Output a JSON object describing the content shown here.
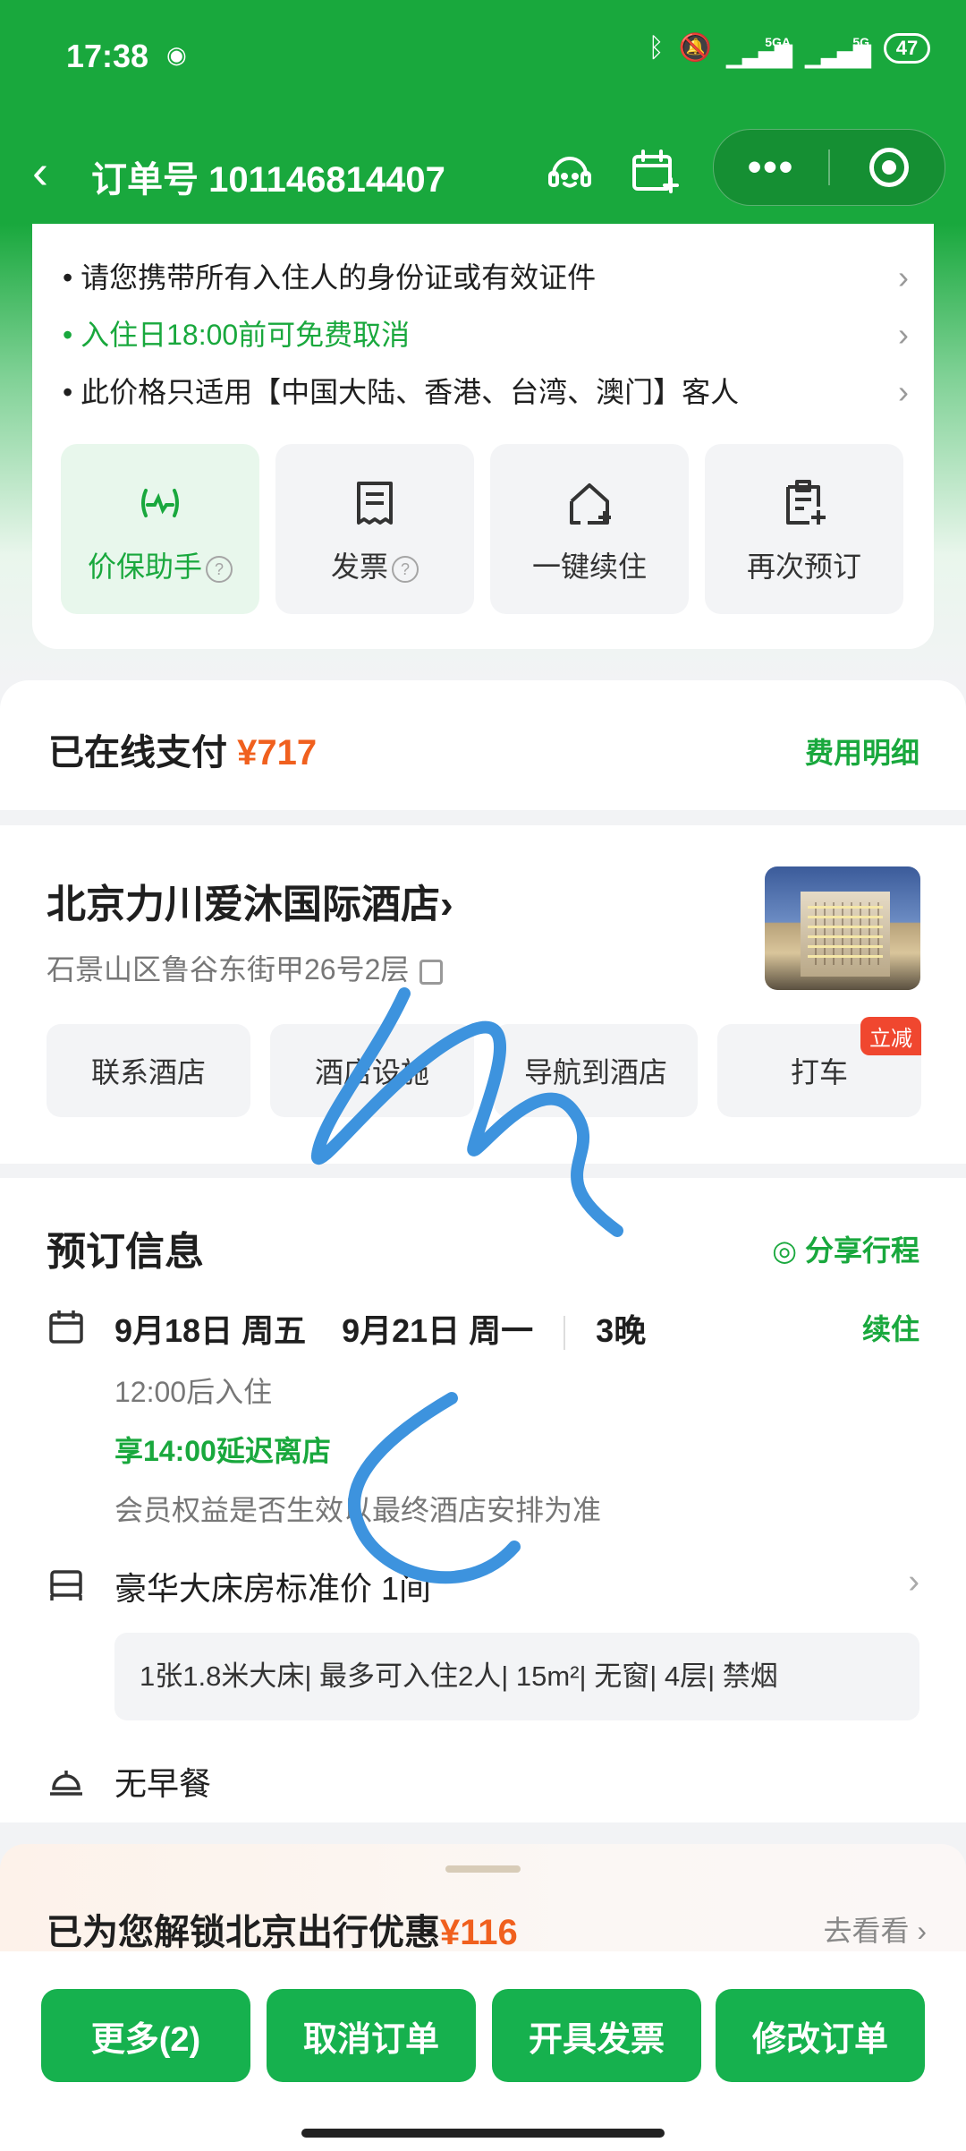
{
  "status_bar": {
    "time": "17:38",
    "network_1": "5GA",
    "network_2": "5G",
    "battery": "47"
  },
  "header": {
    "title": "订单号 101146814407"
  },
  "notices": [
    {
      "text": "请您携带所有入住人的身份证或有效证件",
      "highlight": false
    },
    {
      "text": "入住日18:00前可免费取消",
      "highlight": true
    },
    {
      "text": "此价格只适用【中国大陆、香港、台湾、澳门】客人",
      "highlight": false
    }
  ],
  "quick_actions": [
    {
      "label": "价保助手",
      "icon": "price-protect-icon"
    },
    {
      "label": "发票",
      "icon": "invoice-icon"
    },
    {
      "label": "一键续住",
      "icon": "house-plus-icon"
    },
    {
      "label": "再次预订",
      "icon": "rebook-icon"
    }
  ],
  "payment": {
    "label": "已在线支付",
    "amount": "¥717",
    "detail_link": "费用明细"
  },
  "hotel": {
    "name": "北京力川爱沐国际酒店",
    "address": "石景山区鲁谷东街甲26号2层",
    "buttons": [
      "联系酒店",
      "酒店设施",
      "导航到酒店",
      "打车"
    ],
    "taxi_badge": "立减"
  },
  "booking": {
    "title": "预订信息",
    "share": "分享行程",
    "checkin": "9月18日 周五",
    "checkout": "9月21日 周一",
    "nights": "3晚",
    "extend": "续住",
    "checkin_time": "12:00后入住",
    "late_checkout": "享14:00延迟离店",
    "member_note": "会员权益是否生效以最终酒店安排为准",
    "room": "豪华大床房标准价 1间",
    "room_detail": "1张1.8米大床| 最多可入住2人| 15m²| 无窗| 4层| 禁烟",
    "meal": "无早餐"
  },
  "promo": {
    "text": "已为您解锁北京出行优惠",
    "amount": "¥116",
    "link": "去看看"
  },
  "actions": [
    "更多(2)",
    "取消订单",
    "开具发票",
    "修改订单"
  ],
  "colors": {
    "primary_green": "#19a83d",
    "button_green": "#16b14e",
    "price_orange": "#f0601e",
    "badge_red": "#f0472f"
  }
}
